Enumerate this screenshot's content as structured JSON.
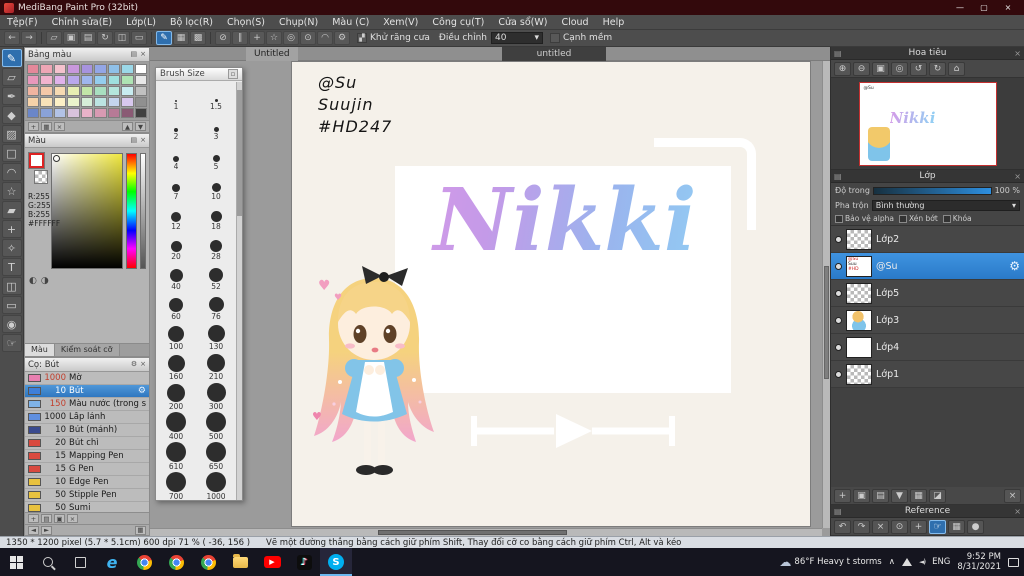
{
  "icons": {
    "close": "×",
    "min": "—",
    "max": "▢",
    "gear": "⚙",
    "caret": "▾",
    "dock": "▤",
    "stairs": "▞",
    "check": ""
  },
  "window": {
    "title": "MediBang Paint Pro (32bit)"
  },
  "menu": {
    "items": [
      "Tệp(F)",
      "Chỉnh sửa(E)",
      "Lớp(L)",
      "Bộ lọc(R)",
      "Chọn(S)",
      "Chụp(N)",
      "Màu (C)",
      "Xem(V)",
      "Công cụ(T)",
      "Cửa sổ(W)",
      "Cloud",
      "Help"
    ]
  },
  "toolbar": {
    "icons": [
      {
        "name": "undo-icon",
        "glyph": "←"
      },
      {
        "name": "redo-icon",
        "glyph": "→"
      },
      {
        "sep": true
      },
      {
        "name": "transform-icon",
        "glyph": "▱"
      },
      {
        "name": "copy-icon",
        "glyph": "▣"
      },
      {
        "name": "paste-icon",
        "glyph": "▤"
      },
      {
        "name": "rotate-icon",
        "glyph": "↻"
      },
      {
        "name": "flip-icon",
        "glyph": "◫"
      },
      {
        "name": "ruler-icon",
        "glyph": "▭"
      },
      {
        "sep": true
      },
      {
        "name": "brush-mode-icon",
        "glyph": "✎",
        "sel": true
      },
      {
        "name": "grid-icon",
        "glyph": "▦"
      },
      {
        "name": "pixel-grid-icon",
        "glyph": "▩"
      },
      {
        "sep": true
      },
      {
        "name": "snap-off-icon",
        "glyph": "⊘"
      },
      {
        "name": "snap-parallel-icon",
        "glyph": "∥"
      },
      {
        "name": "snap-cross-icon",
        "glyph": "+"
      },
      {
        "name": "snap-vanishing-icon",
        "glyph": "☆"
      },
      {
        "name": "snap-radial-icon",
        "glyph": "◎"
      },
      {
        "name": "snap-circle-icon",
        "glyph": "⊙"
      },
      {
        "name": "snap-curve-icon",
        "glyph": "◠"
      },
      {
        "name": "snap-settings-icon",
        "glyph": "⚙"
      }
    ],
    "antialias_label": "Khử răng cưa",
    "adjust_label": "Điều chỉnh",
    "adjust_value": "40",
    "soft_edge_label": "Cạnh mềm"
  },
  "toolstrip": [
    {
      "name": "brush-tool-icon",
      "glyph": "✎",
      "sel": true
    },
    {
      "name": "eraser-tool-icon",
      "glyph": "▱"
    },
    {
      "name": "pen-tool-icon",
      "glyph": "✒"
    },
    {
      "name": "fill-tool-icon",
      "glyph": "◆"
    },
    {
      "name": "gradient-tool-icon",
      "glyph": "▨"
    },
    {
      "name": "select-tool-icon",
      "glyph": "□"
    },
    {
      "name": "lasso-tool-icon",
      "glyph": "◠"
    },
    {
      "name": "magic-wand-tool-icon",
      "glyph": "☆"
    },
    {
      "name": "select-pen-tool-icon",
      "glyph": "▰"
    },
    {
      "name": "move-tool-icon",
      "glyph": "+"
    },
    {
      "name": "eyedropper-tool-icon",
      "glyph": "✧"
    },
    {
      "name": "text-tool-icon",
      "glyph": "T"
    },
    {
      "name": "divide-tool-icon",
      "glyph": "◫"
    },
    {
      "name": "operation-tool-icon",
      "glyph": "▭"
    },
    {
      "name": "zoom-tool-icon",
      "glyph": "◉"
    },
    {
      "name": "hand-tool-icon",
      "glyph": "☞"
    }
  ],
  "palette": {
    "title": "Bảng màu",
    "colors": [
      "#e4889a",
      "#eea6b5",
      "#f4c2cd",
      "#c998dd",
      "#a793de",
      "#93a6e6",
      "#8fc0e8",
      "#9bd8e8",
      "#ffffff",
      "#e898bc",
      "#f2b4ce",
      "#e0b2ea",
      "#b9a8ec",
      "#9fb6ee",
      "#94cdee",
      "#9fe0de",
      "#aee4b4",
      "#e8e8e8",
      "#f0b4a0",
      "#f4c8a8",
      "#f6dab2",
      "#e6eeb2",
      "#c2e6a8",
      "#a8dfc0",
      "#b4e6dc",
      "#c8ecf0",
      "#c0c0c0",
      "#f6d2a8",
      "#f8e2b8",
      "#fcf0c6",
      "#eaf4cc",
      "#d6eed8",
      "#bce4e2",
      "#c4d4ee",
      "#d8c8ee",
      "#909090",
      "#6b86c8",
      "#8aa2d8",
      "#b2c2e6",
      "#d8c2dc",
      "#e8b2c8",
      "#d89ab2",
      "#b67a96",
      "#8a5a74",
      "#404040"
    ]
  },
  "color_panel": {
    "title": "Màu",
    "r": "R:255",
    "g": "G:255",
    "b": "B:255",
    "hex": "#FFFFFF",
    "tab_color": "Màu",
    "tab_size": "Kiểm soát cỡ"
  },
  "brushes": {
    "title": "Cọ: Bút",
    "items": [
      {
        "size": "1000",
        "name": "Mờ",
        "color": "#e87fb0",
        "num_color": "#c2402e"
      },
      {
        "size": "10",
        "name": "Bút",
        "color": "#3f7fd9",
        "selected": true
      },
      {
        "size": "150",
        "name": "Màu nước (trong suố",
        "color": "#7fb3e8",
        "num_color": "#c2402e"
      },
      {
        "size": "1000",
        "name": "Lấp lánh",
        "color": "#5f8fe0",
        "num_color": "#222222"
      },
      {
        "size": "10",
        "name": "Bút (mảnh)",
        "color": "#394a8f",
        "num_color": "#222222"
      },
      {
        "size": "20",
        "name": "Bút chì",
        "color": "#d94a3f",
        "num_color": "#222222"
      },
      {
        "size": "15",
        "name": "Mapping Pen",
        "color": "#d94a3f",
        "num_color": "#222222"
      },
      {
        "size": "15",
        "name": "G Pen",
        "color": "#d94a3f",
        "num_color": "#222222"
      },
      {
        "size": "10",
        "name": "Edge Pen",
        "color": "#e8c23f",
        "num_color": "#222222"
      },
      {
        "size": "50",
        "name": "Stipple Pen",
        "color": "#e8c23f",
        "num_color": "#222222"
      },
      {
        "size": "50",
        "name": "Sumi",
        "color": "#e8c23f",
        "num_color": "#222222"
      }
    ]
  },
  "brush_size": {
    "title": "Brush Size",
    "pairs": [
      [
        "1",
        "1.5"
      ],
      [
        "2",
        "3"
      ],
      [
        "4",
        "5"
      ],
      [
        "7",
        "10"
      ],
      [
        "12",
        "18"
      ],
      [
        "20",
        "28"
      ],
      [
        "40",
        "52"
      ],
      [
        "60",
        "76"
      ],
      [
        "100",
        "130"
      ],
      [
        "160",
        "210"
      ],
      [
        "200",
        "300"
      ],
      [
        "400",
        "500"
      ],
      [
        "610",
        "650"
      ],
      [
        "700",
        "1000"
      ]
    ]
  },
  "doc_tabs": {
    "tab": "Untitled",
    "floating_title": "untitled"
  },
  "canvas": {
    "line1": "@Su",
    "line2": "Suujin",
    "line3": "#HD247",
    "title_text": "Nikki"
  },
  "navigator": {
    "title": "Hoa tiêu",
    "icons": [
      {
        "name": "nav-zoom-in-icon",
        "glyph": "⊕"
      },
      {
        "name": "nav-zoom-out-icon",
        "glyph": "⊖"
      },
      {
        "name": "nav-fit-icon",
        "glyph": "▣"
      },
      {
        "name": "nav-actual-size-icon",
        "glyph": "◎"
      },
      {
        "name": "nav-rotate-left-icon",
        "glyph": "↺"
      },
      {
        "name": "nav-rotate-right-icon",
        "glyph": "↻"
      },
      {
        "name": "nav-reset-icon",
        "glyph": "⌂"
      }
    ]
  },
  "layers_panel": {
    "title": "Lớp",
    "opacity_label": "Độ trong",
    "opacity_value": "100 %",
    "blend_label": "Pha trộn",
    "blend_value": "Bình thường",
    "checkboxes": [
      "Bảo vệ alpha",
      "Xén bớt",
      "Khóa"
    ],
    "layers": [
      {
        "name": "Lớp2",
        "thumb": "checker"
      },
      {
        "name": "@Su",
        "thumb": "text",
        "selected": true
      },
      {
        "name": "Lớp5",
        "thumb": "checker"
      },
      {
        "name": "Lớp3",
        "thumb": "art"
      },
      {
        "name": "Lớp4",
        "thumb": "white"
      },
      {
        "name": "Lớp1",
        "thumb": "checker"
      }
    ],
    "thumb_text": [
      "@Su",
      "Suu",
      "#HD"
    ],
    "buttons": [
      {
        "name": "add-layer-icon",
        "glyph": "+"
      },
      {
        "name": "duplicate-layer-icon",
        "glyph": "▣"
      },
      {
        "name": "layer-folder-icon",
        "glyph": "▤"
      },
      {
        "name": "merge-down-icon",
        "glyph": "▼"
      },
      {
        "name": "clear-layer-icon",
        "glyph": "▦"
      },
      {
        "name": "layer-color-icon",
        "glyph": "◪"
      },
      {
        "name": "delete-layer-icon",
        "glyph": "×"
      }
    ]
  },
  "reference": {
    "title": "Reference",
    "icons": [
      {
        "name": "ref-undo-icon",
        "glyph": "↶"
      },
      {
        "name": "ref-redo-icon",
        "glyph": "↷"
      },
      {
        "name": "ref-clear-icon",
        "glyph": "×"
      },
      {
        "name": "ref-eyedropper-icon",
        "glyph": "⊙"
      },
      {
        "name": "ref-move-icon",
        "glyph": "+"
      },
      {
        "name": "ref-hand-icon",
        "glyph": "☞",
        "sel": true
      },
      {
        "name": "ref-grid-icon",
        "glyph": "▦"
      },
      {
        "name": "ref-color-icon",
        "glyph": "●"
      }
    ]
  },
  "statusbar": {
    "info": "1350 * 1200 pixel  (5.7 * 5.1cm)  600 dpi  71 %  ( -36, 156 )",
    "hint": "Vẽ một đường thẳng bằng cách giữ phím Shift, Thay đổi cỡ co bằng cách giữ phím Ctrl, Alt và kéo"
  },
  "taskbar": {
    "apps": [
      {
        "name": "edge",
        "glyph": "e"
      },
      {
        "name": "chrome-1"
      },
      {
        "name": "chrome-2"
      },
      {
        "name": "chrome-3"
      },
      {
        "name": "file-explorer"
      },
      {
        "name": "youtube",
        "glyph": "▶"
      },
      {
        "name": "tiktok",
        "glyph": "♪"
      },
      {
        "name": "skype",
        "glyph": "S",
        "active": true
      }
    ],
    "weather": "86°F Heavy t storms",
    "lang": "ENG",
    "time": "9:52 PM",
    "date": "8/31/2021"
  }
}
